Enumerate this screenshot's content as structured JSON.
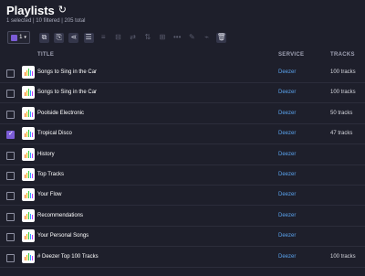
{
  "header": {
    "title": "Playlists",
    "refresh_icon": "↻",
    "subtitle": "1 selected | 10 filtered | 205 total"
  },
  "toolbar": {
    "selected_count": "1",
    "caret": "▾",
    "icons": [
      {
        "name": "merge-icon",
        "glyph": "⧉",
        "enabled": true
      },
      {
        "name": "copy-icon",
        "glyph": "⎘",
        "enabled": true
      },
      {
        "name": "share-icon",
        "glyph": "⋖",
        "enabled": true
      },
      {
        "name": "edit-list-icon",
        "glyph": "☰",
        "enabled": true
      },
      {
        "name": "sort-icon",
        "glyph": "≡",
        "enabled": false
      },
      {
        "name": "copy-to-icon",
        "glyph": "⊟",
        "enabled": false
      },
      {
        "name": "transfer-icon",
        "glyph": "⇄",
        "enabled": false
      },
      {
        "name": "filter-sort-icon",
        "glyph": "⇅",
        "enabled": false
      },
      {
        "name": "dedupe-icon",
        "glyph": "⊞",
        "enabled": false
      },
      {
        "name": "more-icon",
        "glyph": "•••",
        "enabled": false
      },
      {
        "name": "rename-icon",
        "glyph": "✎",
        "enabled": false
      },
      {
        "name": "brush-icon",
        "glyph": "⌁",
        "enabled": false
      },
      {
        "name": "trash-icon",
        "glyph": "🗑",
        "enabled": true
      }
    ]
  },
  "table": {
    "columns": {
      "title": "TITLE",
      "service": "SERVICE",
      "tracks": "TRACKS"
    },
    "rows": [
      {
        "name": "Songs to Sing in the Car",
        "service": "Deezer",
        "tracks": "100 tracks",
        "checked": false
      },
      {
        "name": "Songs to Sing in the Car",
        "service": "Deezer",
        "tracks": "100 tracks",
        "checked": false
      },
      {
        "name": "Poolside Electronic",
        "service": "Deezer",
        "tracks": "50 tracks",
        "checked": false
      },
      {
        "name": "Tropical Disco",
        "service": "Deezer",
        "tracks": "47 tracks",
        "checked": true
      },
      {
        "name": "History",
        "service": "Deezer",
        "tracks": "",
        "checked": false
      },
      {
        "name": "Top Tracks",
        "service": "Deezer",
        "tracks": "",
        "checked": false
      },
      {
        "name": "Your Flow",
        "service": "Deezer",
        "tracks": "",
        "checked": false
      },
      {
        "name": "Recommendations",
        "service": "Deezer",
        "tracks": "",
        "checked": false
      },
      {
        "name": "Your Personal Songs",
        "service": "Deezer",
        "tracks": "",
        "checked": false
      },
      {
        "name": "# Deezer Top 100 Tracks",
        "service": "Deezer",
        "tracks": "100 tracks",
        "checked": false
      }
    ]
  },
  "colors": {
    "background": "#1e1f2b",
    "accent": "#7b5cd6",
    "service_link": "#5aa3ee",
    "deezer_bars": [
      "#ff6b00",
      "#ffb400",
      "#3ecf3e",
      "#2aa3ff",
      "#c43cff"
    ]
  }
}
